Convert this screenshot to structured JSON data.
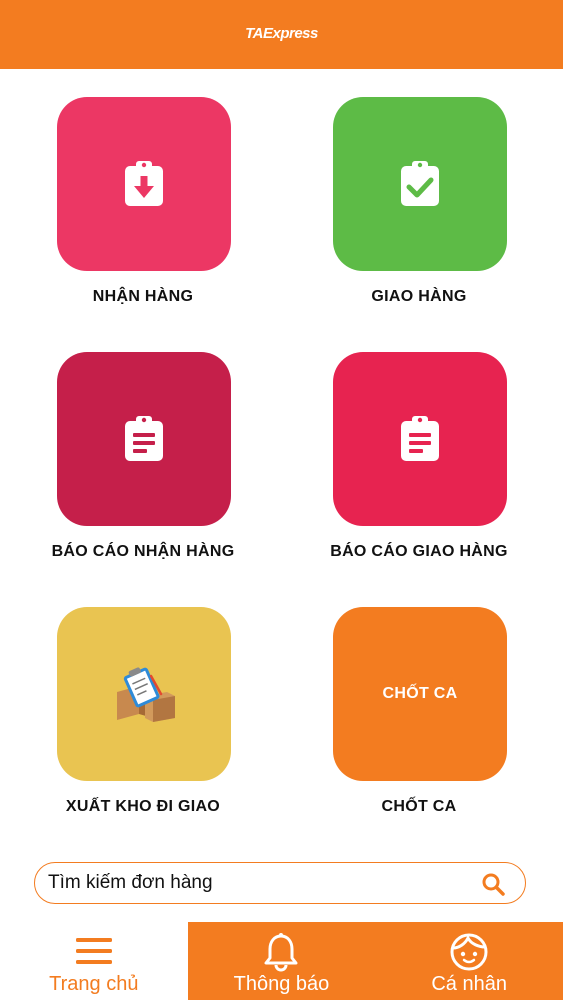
{
  "header": {
    "brand": "TAExpress"
  },
  "tiles": [
    {
      "label": "NHẬN HÀNG",
      "color": "#ec3764",
      "icon": "clipboard-download-icon"
    },
    {
      "label": "GIAO HÀNG",
      "color": "#5dbb46",
      "icon": "clipboard-check-icon"
    },
    {
      "label": "BÁO CÁO NHẬN HÀNG",
      "color": "#c51f4a",
      "icon": "clipboard-list-icon"
    },
    {
      "label": "BÁO CÁO GIAO HÀNG",
      "color": "#e72350",
      "icon": "clipboard-list-icon"
    },
    {
      "label": "XUẤT KHO ĐI GIAO",
      "color": "#e9c451",
      "icon": "boxes-checklist-icon"
    },
    {
      "label": "CHỐT CA",
      "color": "#f37c20",
      "icon_text": "CHỐT CA"
    }
  ],
  "search": {
    "placeholder": "Tìm kiếm đơn hàng"
  },
  "tabs": [
    {
      "label": "Trang chủ",
      "icon": "menu-icon",
      "active": true
    },
    {
      "label": "Thông báo",
      "icon": "bell-icon",
      "active": false
    },
    {
      "label": "Cá nhân",
      "icon": "face-icon",
      "active": false
    }
  ],
  "colors": {
    "accent": "#f37c20"
  }
}
